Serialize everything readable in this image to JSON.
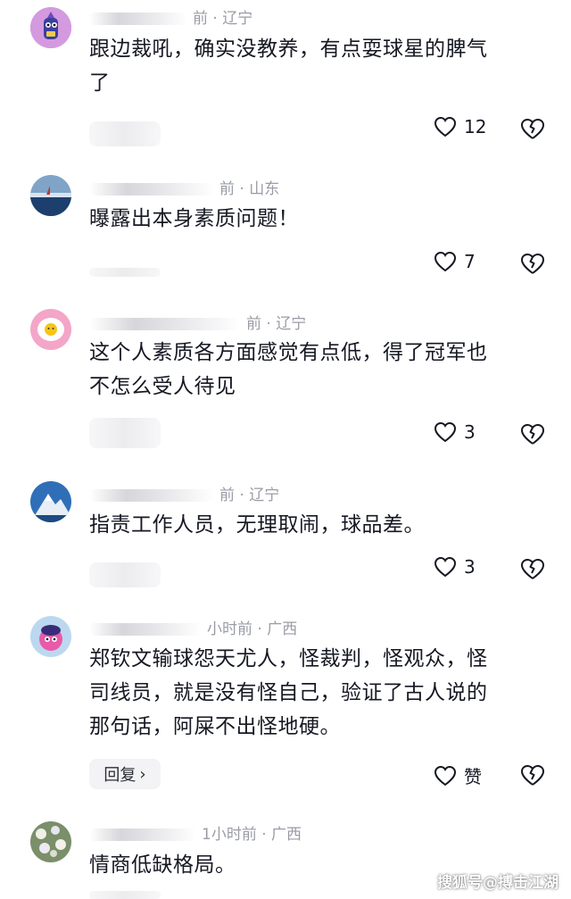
{
  "comments": [
    {
      "meta": "前 · 辽宁",
      "text_lines": [
        "跟边裁吼，确实没教养，有点耍球星的脾气",
        "了"
      ],
      "like_count": "12",
      "reply_label": ""
    },
    {
      "meta": "前 · 山东",
      "text_lines": [
        "曝露出本身素质问题！"
      ],
      "like_count": "7",
      "reply_label": ""
    },
    {
      "meta": "前 · 辽宁",
      "text_lines": [
        "这个人素质各方面感觉有点低，得了冠军也",
        "不怎么受人待见"
      ],
      "like_count": "3",
      "reply_label": ""
    },
    {
      "meta": "前 · 辽宁",
      "text_lines": [
        "指责工作人员，无理取闹，球品差。"
      ],
      "like_count": "3",
      "reply_label": ""
    },
    {
      "meta": "小时前 · 广西",
      "text_lines": [
        "郑钦文输球怨天尤人，怪裁判，怪观众，怪",
        "司线员，就是没有怪自己，验证了古人说的",
        "那句话，阿屎不出怪地硬。"
      ],
      "like_count": "赞",
      "reply_label": "回复"
    },
    {
      "meta": "1小时前 · 广西",
      "text_lines": [
        "情商低缺格局。"
      ],
      "like_count": "",
      "reply_label": ""
    }
  ],
  "icons": {
    "like": "heart-outline-icon",
    "dislike": "broken-heart-icon",
    "reply_chevron": "chevron-right-icon"
  },
  "watermark": "搜狐号@搏击江湖",
  "colors": {
    "text": "#161823",
    "meta": "#9a9ca6",
    "pill": "#f3f3f5"
  }
}
